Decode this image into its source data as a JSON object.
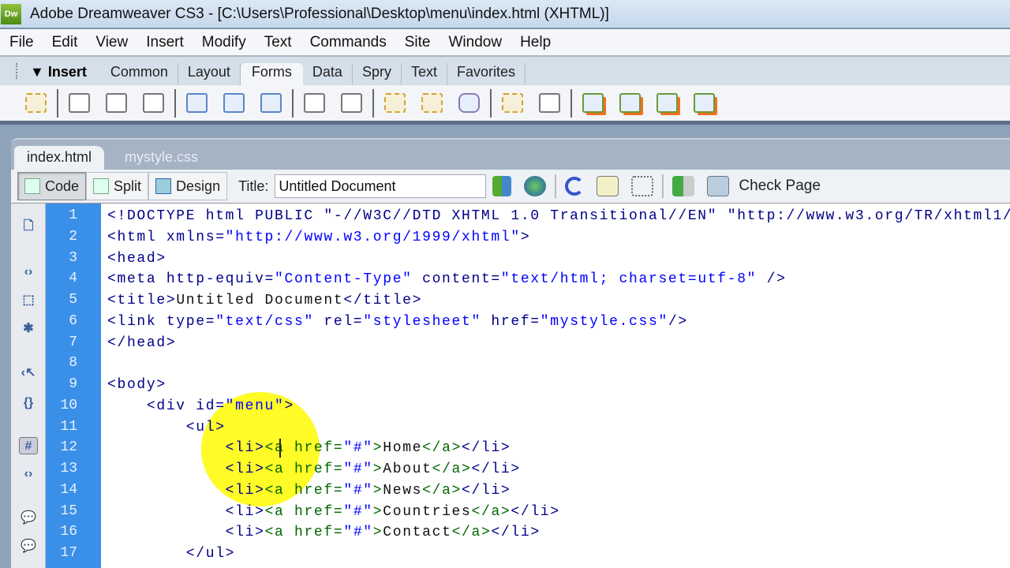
{
  "app": {
    "logo": "Dw",
    "title": "Adobe Dreamweaver CS3 - [C:\\Users\\Professional\\Desktop\\menu\\index.html (XHTML)]"
  },
  "menu": [
    "File",
    "Edit",
    "View",
    "Insert",
    "Modify",
    "Text",
    "Commands",
    "Site",
    "Window",
    "Help"
  ],
  "insert": {
    "label": "▼ Insert",
    "tabs": [
      "Common",
      "Layout",
      "Forms",
      "Data",
      "Spry",
      "Text",
      "Favorites"
    ],
    "active": "Forms"
  },
  "document_tabs": [
    "index.html",
    "mystyle.css"
  ],
  "toolbar": {
    "code": "Code",
    "split": "Split",
    "design": "Design",
    "title_label": "Title:",
    "title_value": "Untitled Document",
    "check_page": "Check Page"
  },
  "line_numbers": [
    "1",
    "2",
    "3",
    "4",
    "5",
    "6",
    "7",
    "8",
    "9",
    "10",
    "11",
    "12",
    "13",
    "14",
    "15",
    "16",
    "17"
  ],
  "code_lines": [
    [
      [
        "<!DOCTYPE html PUBLIC \"-//W3C//DTD XHTML 1.0 Transitional//EN\" \"http://www.w3.org/TR/xhtml1/",
        "t"
      ]
    ],
    [
      [
        "<html xmlns=",
        "t"
      ],
      [
        "\"http://www.w3.org/1999/xhtml\"",
        "v"
      ],
      [
        ">",
        "t"
      ]
    ],
    [
      [
        "<head>",
        "t"
      ]
    ],
    [
      [
        "<meta http-equiv=",
        "t"
      ],
      [
        "\"Content-Type\"",
        "v"
      ],
      [
        " content=",
        "t"
      ],
      [
        "\"text/html; charset=utf-8\"",
        "v"
      ],
      [
        " />",
        "t"
      ]
    ],
    [
      [
        "<title>",
        "t"
      ],
      [
        "Untitled Document",
        "x"
      ],
      [
        "</title>",
        "t"
      ]
    ],
    [
      [
        "<link type=",
        "t"
      ],
      [
        "\"text/css\"",
        "v"
      ],
      [
        " rel=",
        "t"
      ],
      [
        "\"stylesheet\"",
        "v"
      ],
      [
        " href=",
        "t"
      ],
      [
        "\"mystyle.css\"",
        "v"
      ],
      [
        "/>",
        "t"
      ]
    ],
    [
      [
        "</head>",
        "t"
      ]
    ],
    [],
    [
      [
        "<body>",
        "t"
      ]
    ],
    [
      [
        "    <div id=",
        "t"
      ],
      [
        "\"menu\"",
        "v"
      ],
      [
        ">",
        "t"
      ]
    ],
    [
      [
        "        <ul>",
        "t"
      ]
    ],
    [
      [
        "            <li>",
        "t"
      ],
      [
        "<a href=",
        "a"
      ],
      [
        "\"#\"",
        "v"
      ],
      [
        ">",
        "a"
      ],
      [
        "Home",
        "x"
      ],
      [
        "</a>",
        "a"
      ],
      [
        "</li>",
        "t"
      ]
    ],
    [
      [
        "            <li>",
        "t"
      ],
      [
        "<a href=",
        "a"
      ],
      [
        "\"#\"",
        "v"
      ],
      [
        ">",
        "a"
      ],
      [
        "About",
        "x"
      ],
      [
        "</a>",
        "a"
      ],
      [
        "</li>",
        "t"
      ]
    ],
    [
      [
        "            <li>",
        "t"
      ],
      [
        "<a href=",
        "a"
      ],
      [
        "\"#\"",
        "v"
      ],
      [
        ">",
        "a"
      ],
      [
        "News",
        "x"
      ],
      [
        "</a>",
        "a"
      ],
      [
        "</li>",
        "t"
      ]
    ],
    [
      [
        "            <li>",
        "t"
      ],
      [
        "<a href=",
        "a"
      ],
      [
        "\"#\"",
        "v"
      ],
      [
        ">",
        "a"
      ],
      [
        "Countries",
        "x"
      ],
      [
        "</a>",
        "a"
      ],
      [
        "</li>",
        "t"
      ]
    ],
    [
      [
        "            <li>",
        "t"
      ],
      [
        "<a href=",
        "a"
      ],
      [
        "\"#\"",
        "v"
      ],
      [
        ">",
        "a"
      ],
      [
        "Contact",
        "x"
      ],
      [
        "</a>",
        "a"
      ],
      [
        "</li>",
        "t"
      ]
    ],
    [
      [
        "        </ul>",
        "t"
      ]
    ]
  ]
}
